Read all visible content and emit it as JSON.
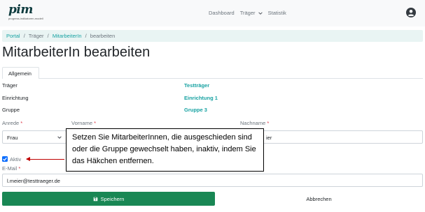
{
  "brand": {
    "logo_text": "pim",
    "logo_subtitle": "progress-indikatoren-modell"
  },
  "nav": {
    "dashboard": "Dashboard",
    "traeger": "Träger",
    "statistik": "Statistik"
  },
  "breadcrumb": {
    "portal": "Portal",
    "traeger": "Träger",
    "mitarbeiterin": "MitarbeiterIn",
    "current": "bearbeiten",
    "separator": "/"
  },
  "page": {
    "title": "MitarbeiterIn bearbeiten"
  },
  "tabs": {
    "allgemein": "Allgemein"
  },
  "info": [
    {
      "label": "Träger",
      "value": "Testträger"
    },
    {
      "label": "Einrichtung",
      "value": "Einrichtung 1"
    },
    {
      "label": "Gruppe",
      "value": "Gruppe 3"
    }
  ],
  "form": {
    "anrede_label": "Anrede",
    "anrede_value": "Frau",
    "vorname_label": "Vorname",
    "nachname_label": "Nachname",
    "nachname_value_visible": "ier",
    "required_marker": "*",
    "aktiv_label": "Aktiv",
    "aktiv_checked": true,
    "email_label": "E-Mail",
    "email_value": "l.meier@testtraeger.de"
  },
  "tooltip": {
    "text": "Setzen Sie MitarbeiterInnen, die ausgeschieden sind oder die Gruppe gewechselt haben, inaktiv, indem Sie das Häkchen entfernen."
  },
  "buttons": {
    "save": "Speichern",
    "cancel": "Abbrechen"
  },
  "colors": {
    "accent": "#17a2a2",
    "save": "#198754",
    "required": "#dc3545",
    "arrow": "#c00000",
    "checkbox": "#0d6efd"
  },
  "icons": {
    "user": "user-circle-icon",
    "save": "floppy-disk-icon",
    "chevron": "chevron-down-icon"
  }
}
